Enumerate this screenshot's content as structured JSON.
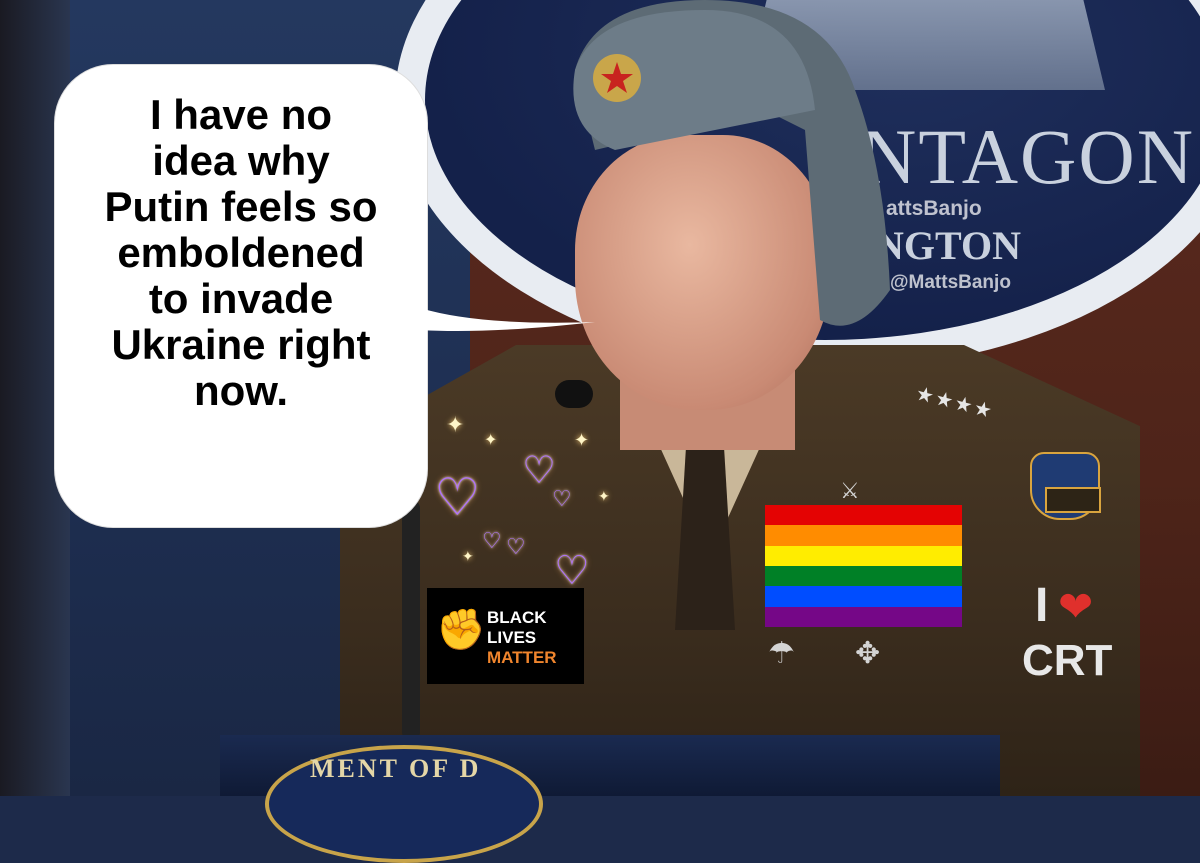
{
  "speech_bubble": {
    "lines": [
      "I have no",
      "idea why",
      "Putin feels so",
      "emboldened",
      "to invade",
      "Ukraine right",
      "now."
    ]
  },
  "background": {
    "seal_text_top": "NTAGON",
    "seal_text_bottom": "NGTON",
    "podium_text": "MENT OF D"
  },
  "watermarks": {
    "upper": "attsBanjo",
    "lower": "@MattsBanjo"
  },
  "stickers": {
    "blm": {
      "line1": "BLACK",
      "line2": "LIVES",
      "line3": "MATTER"
    },
    "crt": {
      "prefix": "I",
      "suffix": "CRT"
    },
    "pride_flag_colors": [
      "#e40303",
      "#ff8c00",
      "#ffed00",
      "#008026",
      "#004dff",
      "#750787"
    ]
  },
  "colors": {
    "bubble": "#ffffff",
    "text": "#000000",
    "heart": "#e0302c",
    "blm_accent": "#f0852d"
  }
}
